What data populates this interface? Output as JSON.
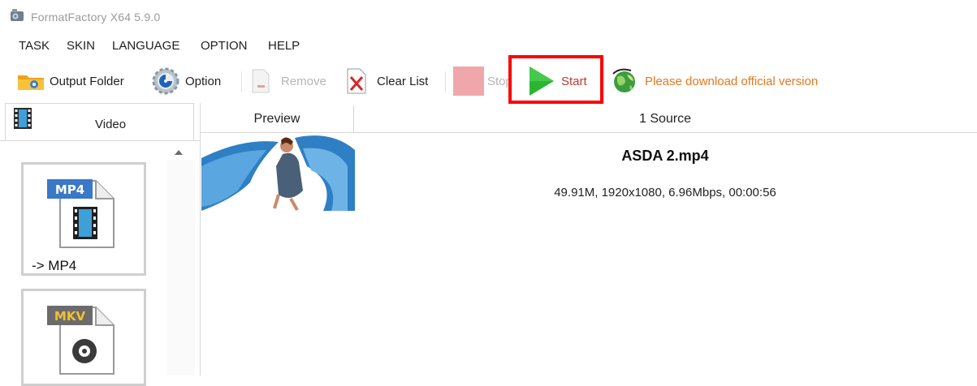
{
  "window": {
    "title": "FormatFactory X64 5.9.0"
  },
  "menu": [
    {
      "label": "TASK"
    },
    {
      "label": "SKIN"
    },
    {
      "label": "LANGUAGE"
    },
    {
      "label": "OPTION"
    },
    {
      "label": "HELP"
    }
  ],
  "toolbar": {
    "output_folder": "Output Folder",
    "option": "Option",
    "remove": "Remove",
    "clear_list": "Clear List",
    "stop": "Stop",
    "start": "Start",
    "download_notice": "Please download official version"
  },
  "sidebar": {
    "tab_label": "Video",
    "formats": [
      {
        "badge": "MP4",
        "label": "-> MP4"
      },
      {
        "badge": "MKV",
        "label": ""
      }
    ]
  },
  "list": {
    "columns": {
      "preview": "Preview",
      "source": "1 Source"
    },
    "files": [
      {
        "name": "ASDA 2.mp4",
        "info": "49.91M, 1920x1080, 6.96Mbps, 00:00:56"
      }
    ]
  },
  "colors": {
    "start_green": "#2bb534",
    "start_text": "#c0392b",
    "notice_orange": "#e8771c",
    "highlight_red": "#ff0000",
    "disabled_text": "#b5b5b5"
  }
}
